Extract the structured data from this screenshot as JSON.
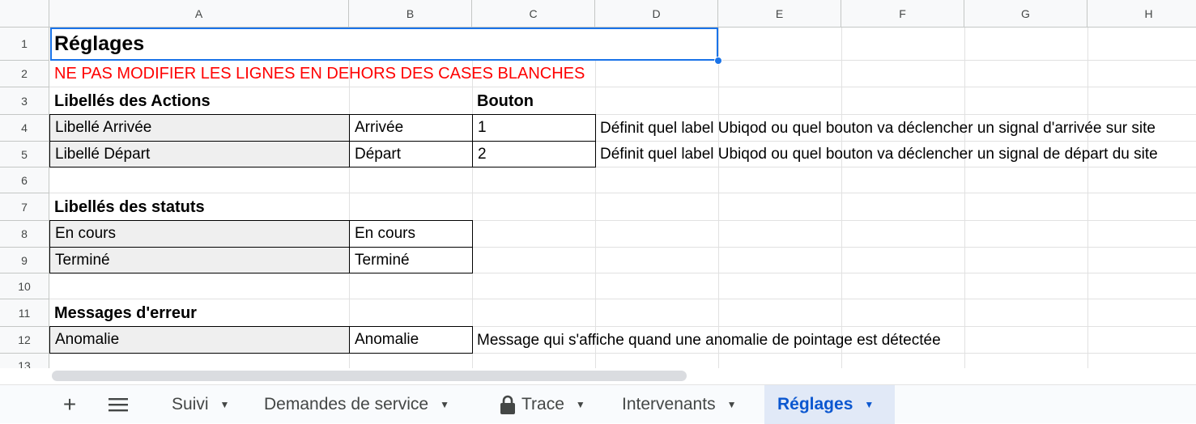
{
  "columns": [
    "A",
    "B",
    "C",
    "D",
    "E",
    "F",
    "G",
    "H"
  ],
  "rows": [
    "1",
    "2",
    "3",
    "4",
    "5",
    "6",
    "7",
    "8",
    "9",
    "10",
    "11",
    "12",
    "13"
  ],
  "cells": {
    "a1": "Réglages",
    "a2": "NE PAS MODIFIER LES LIGNES EN DEHORS DES CASES BLANCHES",
    "a3": "Libellés des Actions",
    "c3": "Bouton",
    "a4": "Libellé Arrivée",
    "b4": "Arrivée",
    "c4": "1",
    "d4": "Définit quel label Ubiqod ou quel bouton va déclencher un signal d'arrivée sur site",
    "a5": "Libellé Départ",
    "b5": "Départ",
    "c5": "2",
    "d5": "Définit quel label Ubiqod ou quel bouton va déclencher un signal de départ du site",
    "a7": "Libellés des statuts",
    "a8": "En cours",
    "b8": "En cours",
    "a9": "Terminé",
    "b9": "Terminé",
    "a11": "Messages d'erreur",
    "a12": "Anomalie",
    "b12": "Anomalie",
    "c12": "Message qui s'affiche quand une anomalie de pointage est détectée"
  },
  "tabs": {
    "add_label": "+",
    "menu_label": "≡",
    "items": [
      "Suivi",
      "Demandes de service",
      "Trace",
      "Intervenants",
      "Réglages"
    ],
    "active": "Réglages"
  },
  "colors": {
    "selection": "#1a73e8",
    "active_tab": "#0b57d0",
    "warning_text": "#ff0000",
    "locked_cell_bg": "#efefef"
  }
}
